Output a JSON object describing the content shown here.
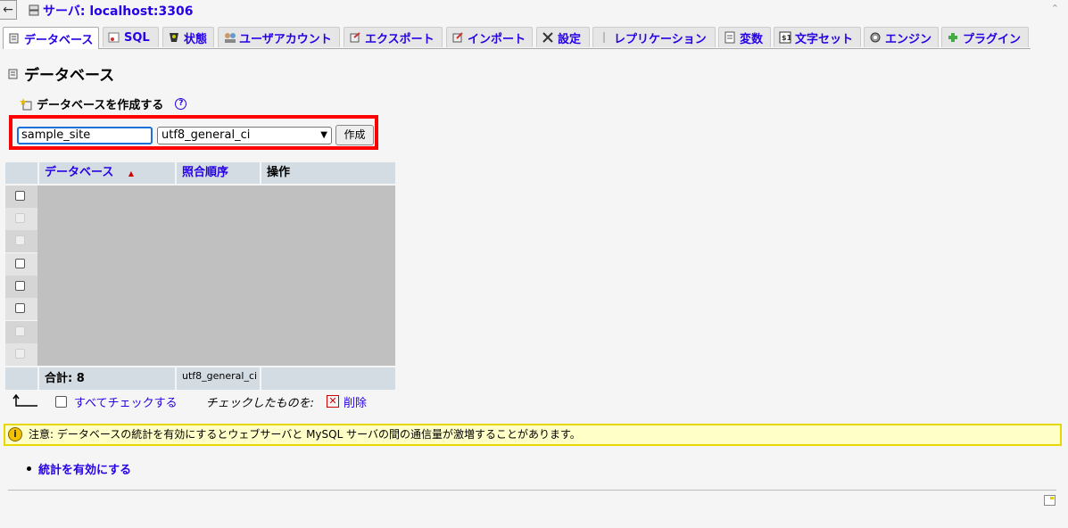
{
  "topbar": {
    "back_glyph": "←",
    "server_label": "サーバ: localhost:3306"
  },
  "tabs": [
    {
      "label": "データベース",
      "icon": "database-icon",
      "active": true
    },
    {
      "label": "SQL",
      "icon": "sql-icon"
    },
    {
      "label": "状態",
      "icon": "status-icon"
    },
    {
      "label": "ユーザアカウント",
      "icon": "users-icon"
    },
    {
      "label": "エクスポート",
      "icon": "export-icon"
    },
    {
      "label": "インポート",
      "icon": "import-icon"
    },
    {
      "label": "設定",
      "icon": "settings-icon"
    },
    {
      "label": "レプリケーション",
      "icon": "replication-icon"
    },
    {
      "label": "変数",
      "icon": "variables-icon"
    },
    {
      "label": "文字セット",
      "icon": "charset-icon"
    },
    {
      "label": "エンジン",
      "icon": "engines-icon"
    },
    {
      "label": "プラグイン",
      "icon": "plugins-icon"
    }
  ],
  "page": {
    "title": "データベース",
    "create_heading": "データベースを作成する",
    "help_glyph": "?"
  },
  "create_form": {
    "db_name_value": "sample_site",
    "collation_value": "utf8_general_ci",
    "create_button": "作成"
  },
  "table": {
    "columns": [
      "データベース",
      "照合順序",
      "操作"
    ],
    "sort_indicator": "▲",
    "rows": [
      {
        "checkbox_enabled": true
      },
      {
        "checkbox_enabled": false
      },
      {
        "checkbox_enabled": false
      },
      {
        "checkbox_enabled": true
      },
      {
        "checkbox_enabled": true
      },
      {
        "checkbox_enabled": true
      },
      {
        "checkbox_enabled": false
      },
      {
        "checkbox_enabled": false
      }
    ],
    "total_label": "合計: 8",
    "total_collation": "utf8_general_ci"
  },
  "bulk": {
    "check_all": "すべてチェックする",
    "with_selected": "チェックしたものを:",
    "delete": "削除"
  },
  "notice": {
    "text": "注意: データベースの統計を有効にするとウェブサーバと MySQL サーバの間の通信量が激増することがあります。"
  },
  "enable_stats_link": "統計を有効にする",
  "colors": {
    "link": "#2600e6",
    "highlight_border": "#ff0000",
    "notice_bg": "#ffffc8",
    "header_bg": "#d3dce3"
  }
}
